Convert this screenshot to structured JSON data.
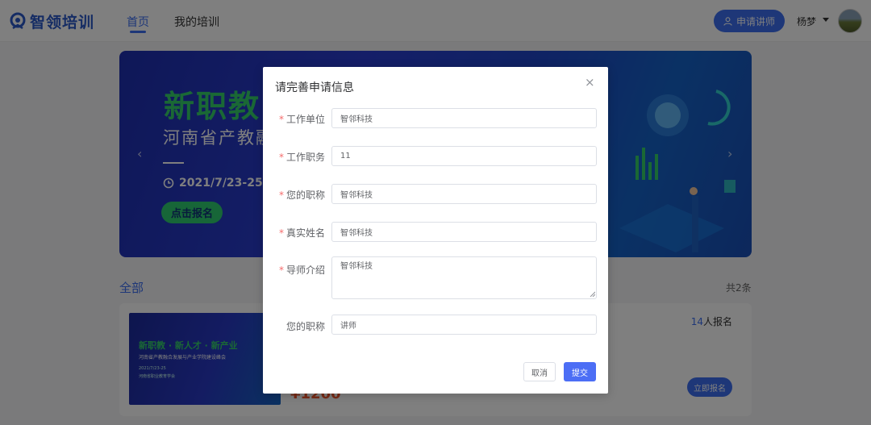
{
  "header": {
    "logo_text": "智领培训",
    "nav": [
      {
        "label": "首页",
        "active": true
      },
      {
        "label": "我的培训",
        "active": false
      }
    ],
    "apply_button": "申请讲师",
    "username": "杨梦"
  },
  "banner": {
    "title": "新职教",
    "subtitle": "河南省产教融",
    "date": "2021/7/23-25",
    "button": "点击报名",
    "prev_arrow": "‹",
    "next_arrow": "›"
  },
  "list": {
    "section_title": "全部",
    "total": "共2条",
    "card": {
      "image_title": "新职教 · 新人才 · 新产业",
      "image_subtitle": "河南省产教融合发展与产业学院建设峰会",
      "image_date": "2021/7/23-25",
      "image_org": "河南省职业教育学会",
      "price": "¥1200",
      "count_number": "14",
      "count_suffix": "人报名",
      "button": "立即报名"
    }
  },
  "modal": {
    "title": "请完善申请信息",
    "close": "×",
    "fields": [
      {
        "label": "工作单位",
        "required": true,
        "value": "智邻科技"
      },
      {
        "label": "工作职务",
        "required": true,
        "value": "11"
      },
      {
        "label": "您的职称",
        "required": true,
        "value": "智邻科技"
      },
      {
        "label": "真实姓名",
        "required": true,
        "value": "智邻科技"
      },
      {
        "label": "导师介绍",
        "required": true,
        "value": "智邻科技"
      },
      {
        "label": "您的职称",
        "required": false,
        "value": "讲师"
      }
    ],
    "cancel": "取消",
    "submit": "提交"
  },
  "colors": {
    "accent": "#3c6ef0",
    "submit": "#4c6ef5",
    "required": "#f56c6c",
    "banner_green": "#35d06a",
    "price": "#f0562c"
  }
}
